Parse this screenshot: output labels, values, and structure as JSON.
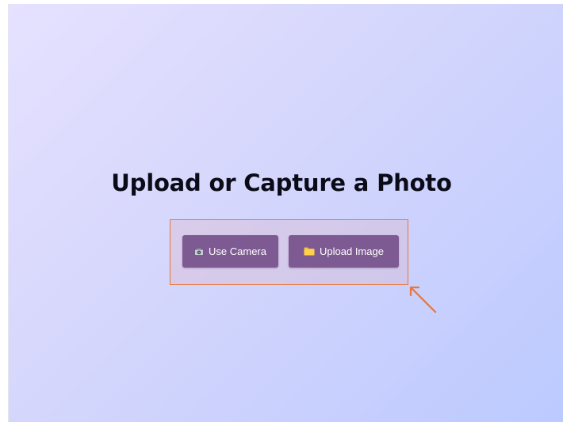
{
  "title": "Upload or Capture a Photo",
  "buttons": {
    "camera": {
      "label": "Use Camera",
      "icon": "camera-icon"
    },
    "upload": {
      "label": "Upload Image",
      "icon": "folder-icon"
    }
  },
  "colors": {
    "button_bg": "#7e5a92",
    "highlight_border": "#e8763a",
    "title": "#0b0b18"
  }
}
